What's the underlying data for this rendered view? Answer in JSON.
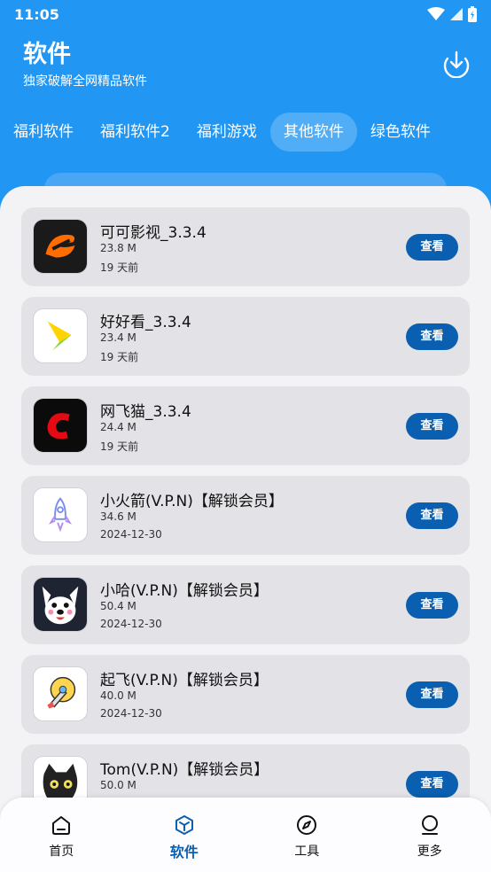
{
  "status": {
    "time": "11:05"
  },
  "header": {
    "title": "软件",
    "subtitle": "独家破解全网精品软件"
  },
  "tabs": [
    {
      "label": "福利软件",
      "active": false
    },
    {
      "label": "福利软件2",
      "active": false
    },
    {
      "label": "福利游戏",
      "active": false
    },
    {
      "label": "其他软件",
      "active": true
    },
    {
      "label": "绿色软件",
      "active": false
    }
  ],
  "apps": [
    {
      "name": "可可影视_3.3.4",
      "size": "23.8 M",
      "date": "19 天前",
      "button": "查看",
      "icon": "keke-icon"
    },
    {
      "name": "好好看_3.3.4",
      "size": "23.4 M",
      "date": "19 天前",
      "button": "查看",
      "icon": "haohaokan-icon"
    },
    {
      "name": "网飞猫_3.3.4",
      "size": "24.4 M",
      "date": "19 天前",
      "button": "查看",
      "icon": "wangfeimao-icon"
    },
    {
      "name": "小火箭(V.P.N)【解锁会员】",
      "size": "34.6 M",
      "date": "2024-12-30",
      "button": "查看",
      "icon": "rocket-icon"
    },
    {
      "name": "小哈(V.P.N)【解锁会员】",
      "size": "50.4 M",
      "date": "2024-12-30",
      "button": "查看",
      "icon": "husky-icon"
    },
    {
      "name": "起飞(V.P.N)【解锁会员】",
      "size": "40.0 M",
      "date": "2024-12-30",
      "button": "查看",
      "icon": "takeoff-icon"
    },
    {
      "name": "Tom(V.P.N)【解锁会员】",
      "size": "50.0 M",
      "date": "",
      "button": "查看",
      "icon": "cat-icon"
    }
  ],
  "nav": [
    {
      "label": "首页",
      "icon": "home-icon",
      "active": false
    },
    {
      "label": "软件",
      "icon": "box-icon",
      "active": true
    },
    {
      "label": "工具",
      "icon": "compass-icon",
      "active": false
    },
    {
      "label": "更多",
      "icon": "more-icon",
      "active": false
    }
  ],
  "colors": {
    "primary": "#2196f3",
    "button": "#0a5fb0",
    "card": "#e2e2e7"
  }
}
